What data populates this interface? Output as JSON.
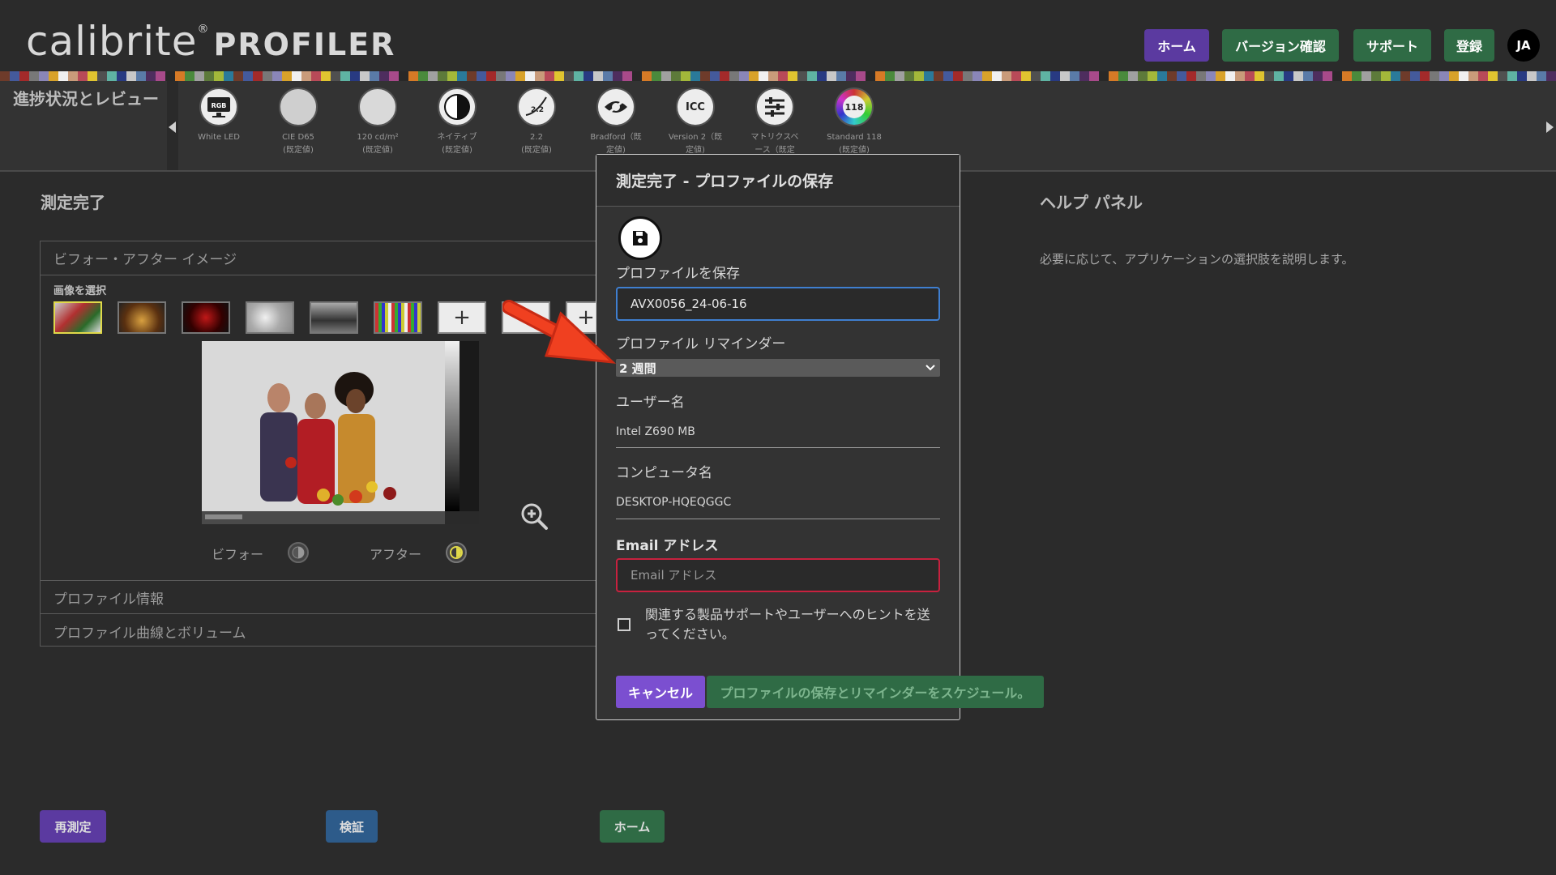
{
  "header": {
    "logo_main": "calibrite",
    "logo_reg": "®",
    "logo_product": "PROFILER",
    "nav": {
      "home": "ホーム",
      "version": "バージョン確認",
      "support": "サポート",
      "register": "登録"
    },
    "avatar": "JA"
  },
  "colors": {
    "accent_purple": "#5b3aa0",
    "accent_green": "#2f6b45",
    "accent_blue": "#2d5b8a",
    "focus_blue": "#3f7fd0",
    "error_red": "#c8213f",
    "arrow_red": "#e8321e"
  },
  "progress": {
    "title": "進捗状況とレビュー",
    "steps": [
      {
        "icon": "monitor-rgb-icon",
        "icon_text": "RGB",
        "label": "White LED",
        "sub": ""
      },
      {
        "icon": "white-point-icon",
        "icon_text": "",
        "label": "CIE D65",
        "sub": "(既定値)"
      },
      {
        "icon": "luminance-icon",
        "icon_text": "",
        "label": "120 cd/m²",
        "sub": "(既定値)"
      },
      {
        "icon": "contrast-icon",
        "icon_text": "",
        "label": "ネイティブ",
        "sub": "(既定値)"
      },
      {
        "icon": "gamma-icon",
        "icon_text": "2.2",
        "label": "2.2",
        "sub": "(既定値)"
      },
      {
        "icon": "bradford-eye-icon",
        "icon_text": "",
        "label": "Bradford（既",
        "sub": "定値)"
      },
      {
        "icon": "icc-icon",
        "icon_text": "ICC",
        "label": "Version 2（既",
        "sub": "定値)"
      },
      {
        "icon": "matrix-sliders-icon",
        "icon_text": "",
        "label": "マトリクスベ",
        "sub": "ース（既定"
      },
      {
        "icon": "patch-set-icon",
        "icon_text": "118",
        "label": "Standard 118",
        "sub": "(既定値)"
      }
    ]
  },
  "main": {
    "section_title": "測定完了",
    "before_after_header": "ビフォー・アフター イメージ",
    "select_image_label": "画像を選択",
    "before_label": "ビフォー",
    "after_label": "アフター",
    "profile_info_header": "プロファイル情報",
    "profile_curves_header": "プロファイル曲線とボリューム"
  },
  "help": {
    "title": "ヘルプ パネル",
    "text": "必要に応じて、アプリケーションの選択肢を説明します。"
  },
  "bottom": {
    "remeasure": "再測定",
    "verify": "検証",
    "home": "ホーム"
  },
  "modal": {
    "title": "測定完了 - プロファイルの保存",
    "save_label": "プロファイルを保存",
    "profile_name_value": "AVX0056_24-06-16",
    "reminder_label": "プロファイル リマインダー",
    "reminder_selected": "2 週間",
    "user_label": "ユーザー名",
    "user_value": "Intel Z690 MB",
    "computer_label": "コンピュータ名",
    "computer_value": "DESKTOP-HQEQGGC",
    "email_label": "Email アドレス",
    "email_placeholder": "Email アドレス",
    "consent_text": "関連する製品サポートやユーザーへのヒントを送ってください。",
    "cancel": "キャンセル",
    "save_schedule": "プロファイルの保存とリマインダーをスケジュール。"
  }
}
